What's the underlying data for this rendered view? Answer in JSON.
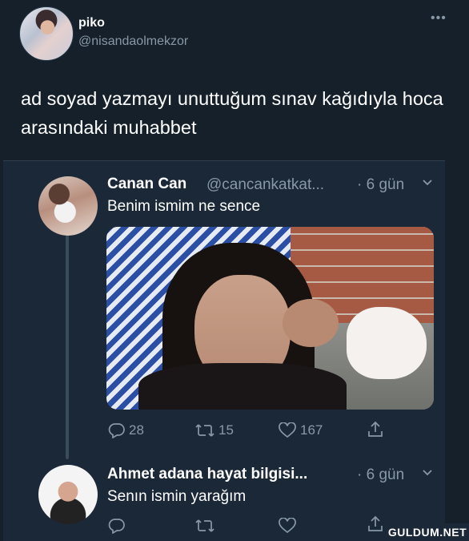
{
  "tweet": {
    "author_name": "piko",
    "author_handle": "@nisandaolmekzor",
    "more_icon": "ellipsis-icon",
    "text": "ad soyad yazmayı unuttuğum sınav kağıdıyla hoca arasındaki muhabbet"
  },
  "embedded": {
    "reply1": {
      "name": "Canan Can",
      "handle": "@cancankatkat...",
      "time": "· 6 gün",
      "text": "Benim ismim ne sence",
      "actions": {
        "reply_count": "28",
        "retweet_count": "15",
        "like_count": "167"
      }
    },
    "reply2": {
      "name": "Ahmet adana hayat bilgisi...",
      "time": "· 6 gün",
      "text": "Senın ismin yarağım"
    }
  },
  "watermark": "GULDUM.NET",
  "colors": {
    "background": "#15202b",
    "secondary_text": "#8899a6",
    "primary_text": "#ffffff"
  }
}
